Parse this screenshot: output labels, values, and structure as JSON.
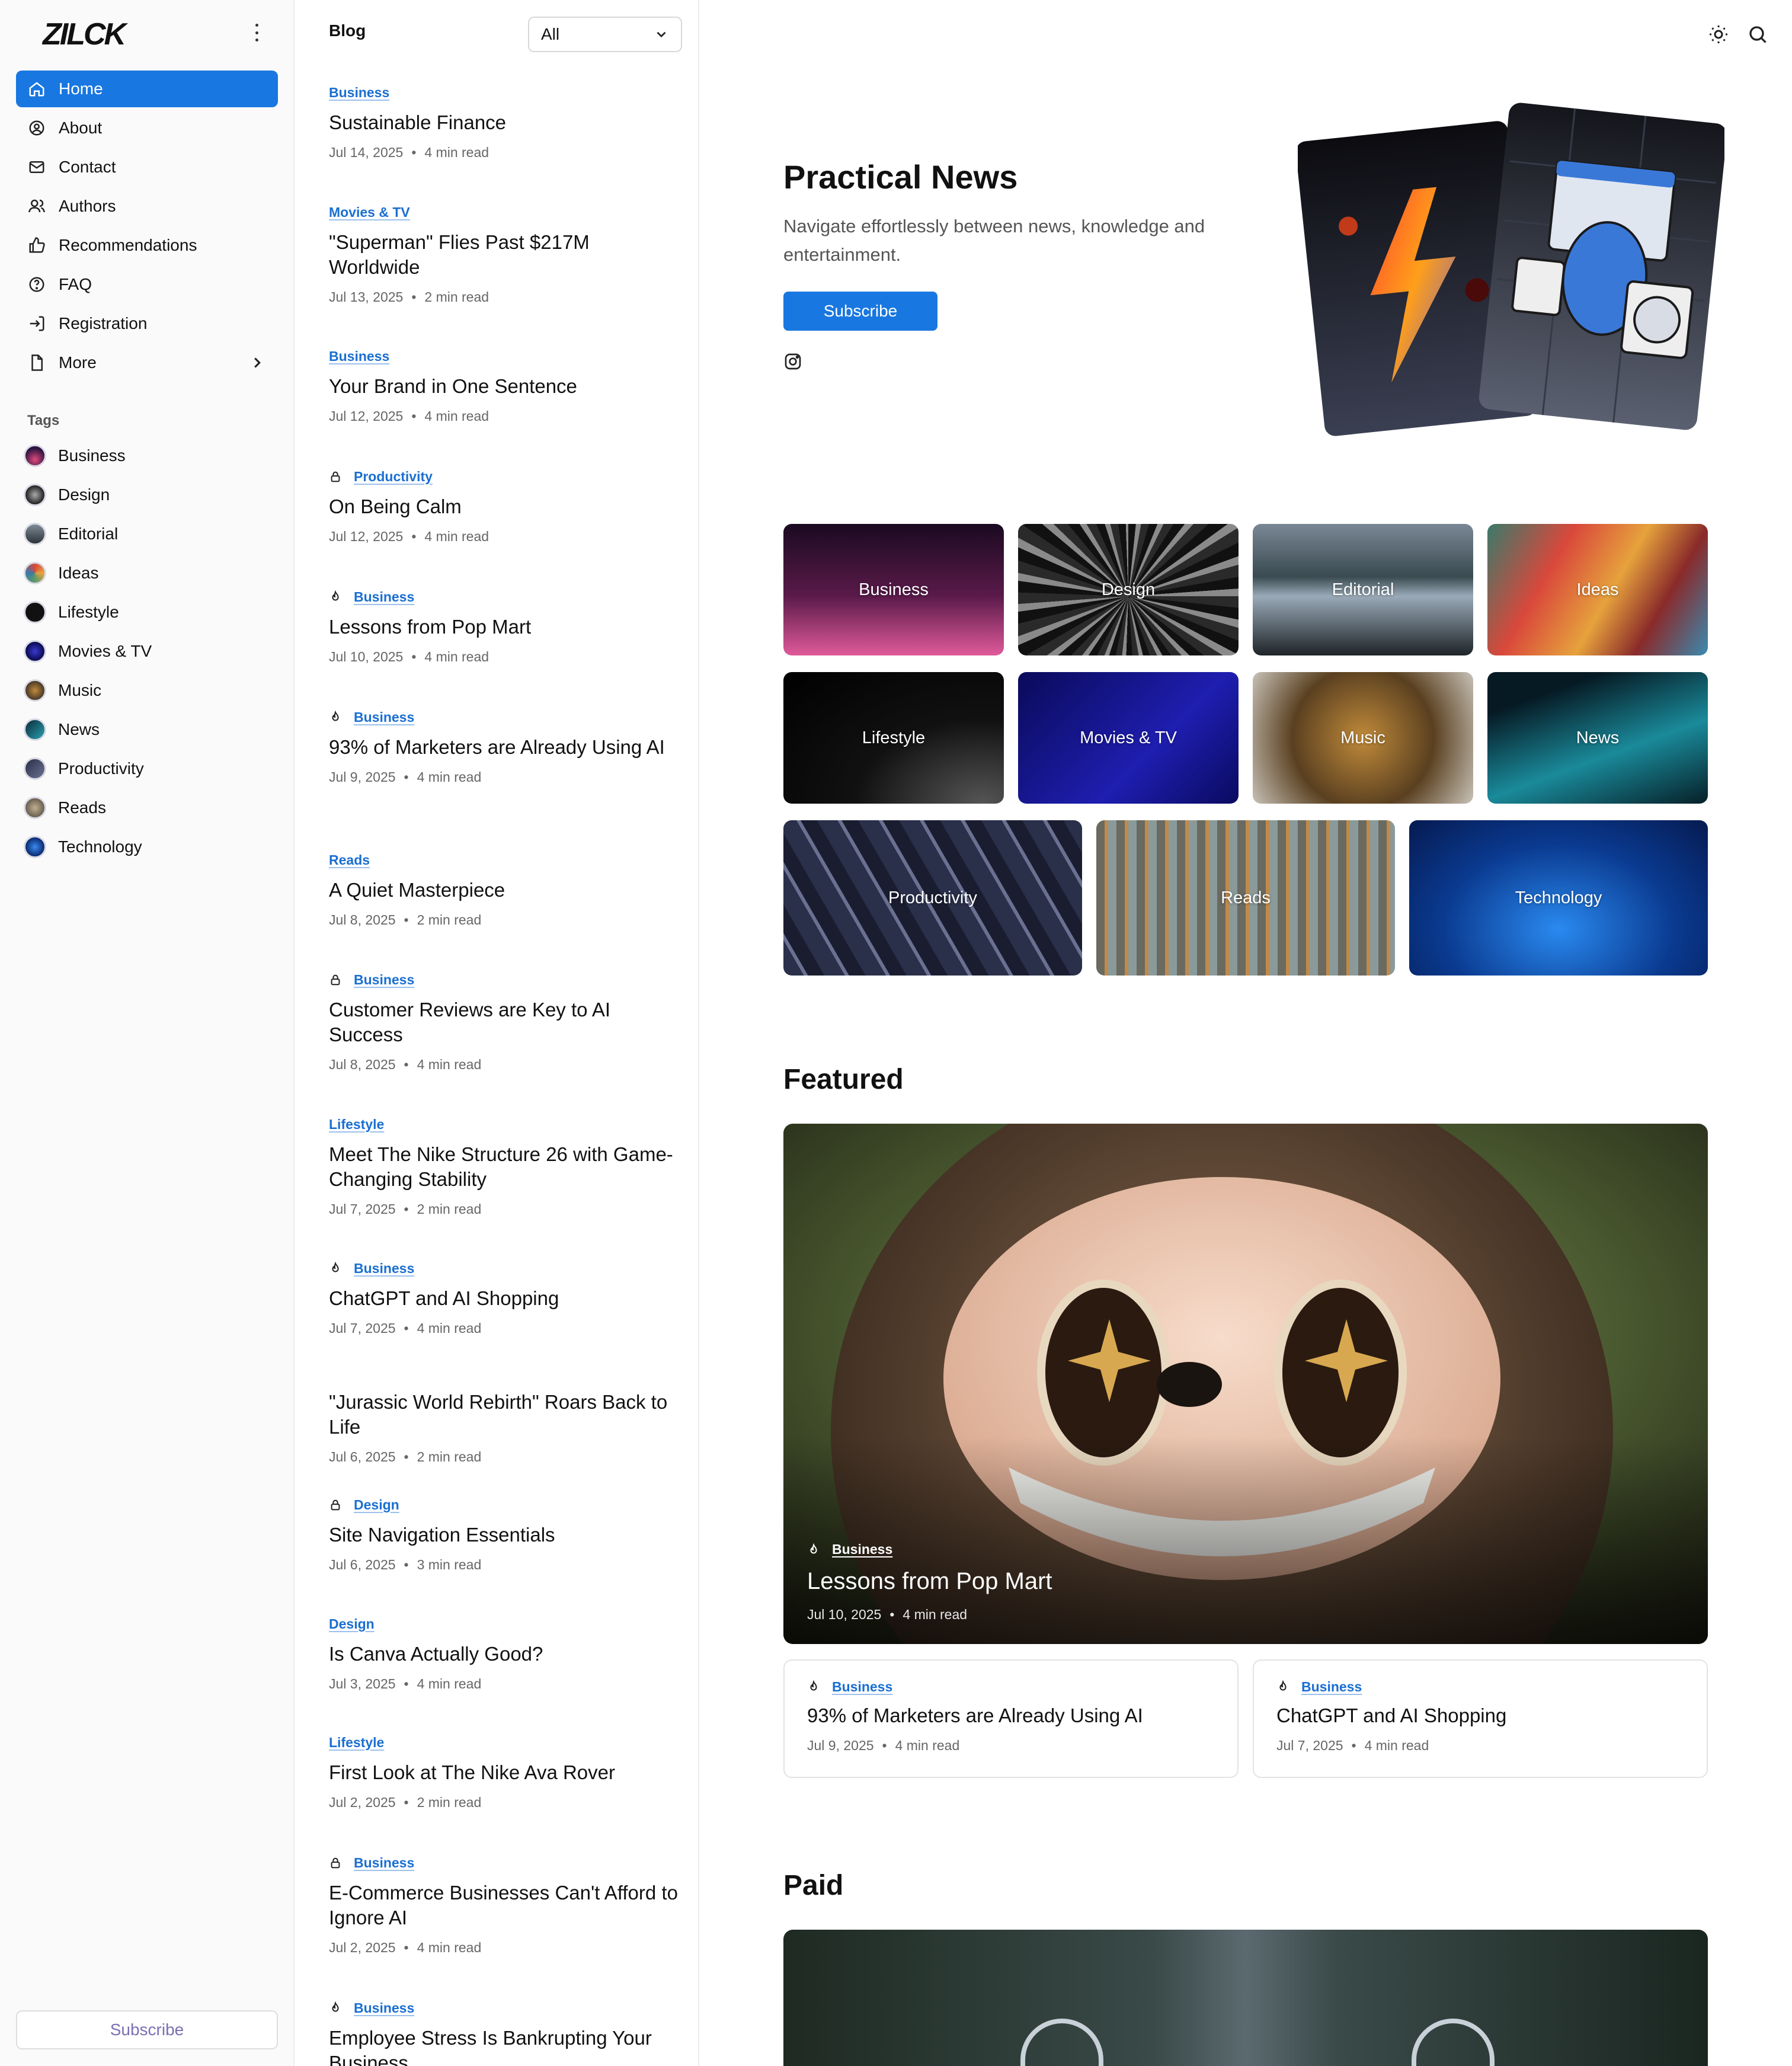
{
  "brand": {
    "logo_text": "ZILCK"
  },
  "nav": {
    "items": [
      {
        "label": "Home"
      },
      {
        "label": "About"
      },
      {
        "label": "Contact"
      },
      {
        "label": "Authors"
      },
      {
        "label": "Recommendations"
      },
      {
        "label": "FAQ"
      },
      {
        "label": "Registration"
      },
      {
        "label": "More"
      }
    ]
  },
  "tags": {
    "label": "Tags",
    "items": [
      {
        "label": "Business",
        "color": "#c2306e"
      },
      {
        "label": "Design",
        "color": "#555a68"
      },
      {
        "label": "Editorial",
        "color": "#5d6b77"
      },
      {
        "label": "Ideas",
        "color": "#d98a2b"
      },
      {
        "label": "Lifestyle",
        "color": "#111111"
      },
      {
        "label": "Movies & TV",
        "color": "#1a1a8c"
      },
      {
        "label": "Music",
        "color": "#8a6a4a"
      },
      {
        "label": "News",
        "color": "#1d5a6a"
      },
      {
        "label": "Productivity",
        "color": "#4a4f6a"
      },
      {
        "label": "Reads",
        "color": "#9a8a70"
      },
      {
        "label": "Technology",
        "color": "#1855c0"
      }
    ]
  },
  "sidebar_subscribe": "Subscribe",
  "blog": {
    "title": "Blog",
    "filter_value": "All",
    "posts": [
      {
        "category": "Business",
        "icon": "none",
        "title": "Sustainable Finance",
        "date": "Jul 14, 2025",
        "read": "4 min read"
      },
      {
        "category": "Movies & TV",
        "icon": "none",
        "title": "\"Superman\" Flies Past $217M Worldwide",
        "date": "Jul 13, 2025",
        "read": "2 min read"
      },
      {
        "category": "Business",
        "icon": "none",
        "title": "Your Brand in One Sentence",
        "date": "Jul 12, 2025",
        "read": "4 min read"
      },
      {
        "category": "Productivity",
        "icon": "lock",
        "title": "On Being Calm",
        "date": "Jul 12, 2025",
        "read": "4 min read"
      },
      {
        "category": "Business",
        "icon": "flame",
        "title": "Lessons from Pop Mart",
        "date": "Jul 10, 2025",
        "read": "4 min read"
      },
      {
        "category": "Business",
        "icon": "flame",
        "title": "93% of Marketers are Already Using AI",
        "date": "Jul 9, 2025",
        "read": "4 min read"
      },
      {
        "category": "Reads",
        "icon": "none",
        "title": "A Quiet Masterpiece",
        "date": "Jul 8, 2025",
        "read": "2 min read"
      },
      {
        "category": "Business",
        "icon": "lock",
        "title": "Customer Reviews are Key to AI Success",
        "date": "Jul 8, 2025",
        "read": "4 min read"
      },
      {
        "category": "Lifestyle",
        "icon": "none",
        "title": "Meet The Nike Structure 26 with Game-Changing Stability",
        "date": "Jul 7, 2025",
        "read": "2 min read"
      },
      {
        "category": "Business",
        "icon": "flame",
        "title": "ChatGPT and AI Shopping",
        "date": "Jul 7, 2025",
        "read": "4 min read"
      },
      {
        "category": "",
        "icon": "none",
        "title": "\"Jurassic World Rebirth\" Roars Back to Life",
        "date": "Jul 6, 2025",
        "read": "2 min read"
      },
      {
        "category": "Design",
        "icon": "lock",
        "title": "Site Navigation Essentials",
        "date": "Jul 6, 2025",
        "read": "3 min read"
      },
      {
        "category": "Design",
        "icon": "none",
        "title": "Is Canva Actually Good?",
        "date": "Jul 3, 2025",
        "read": "4 min read"
      },
      {
        "category": "Lifestyle",
        "icon": "none",
        "title": "First Look at The Nike Ava Rover",
        "date": "Jul 2, 2025",
        "read": "2 min read"
      },
      {
        "category": "Business",
        "icon": "lock",
        "title": "E-Commerce Businesses Can't Afford to Ignore AI",
        "date": "Jul 2, 2025",
        "read": "4 min read"
      },
      {
        "category": "Business",
        "icon": "flame",
        "title": "Employee Stress Is Bankrupting Your Business",
        "date": "",
        "read": ""
      }
    ]
  },
  "hero": {
    "title": "Practical News",
    "subtitle": "Navigate effortlessly between news, knowledge and entertainment.",
    "button": "Subscribe"
  },
  "tiles": [
    "Business",
    "Design",
    "Editorial",
    "Ideas",
    "Lifestyle",
    "Movies & TV",
    "Music",
    "News",
    "Productivity",
    "Reads",
    "Technology"
  ],
  "featured": {
    "heading": "Featured",
    "main": {
      "category": "Business",
      "title": "Lessons from Pop Mart",
      "date": "Jul 10, 2025",
      "read": "4 min read"
    },
    "cards": [
      {
        "category": "Business",
        "title": "93% of Marketers are Already Using AI",
        "date": "Jul 9, 2025",
        "read": "4 min read"
      },
      {
        "category": "Business",
        "title": "ChatGPT and AI Shopping",
        "date": "Jul 7, 2025",
        "read": "4 min read"
      }
    ]
  },
  "paid": {
    "heading": "Paid"
  }
}
